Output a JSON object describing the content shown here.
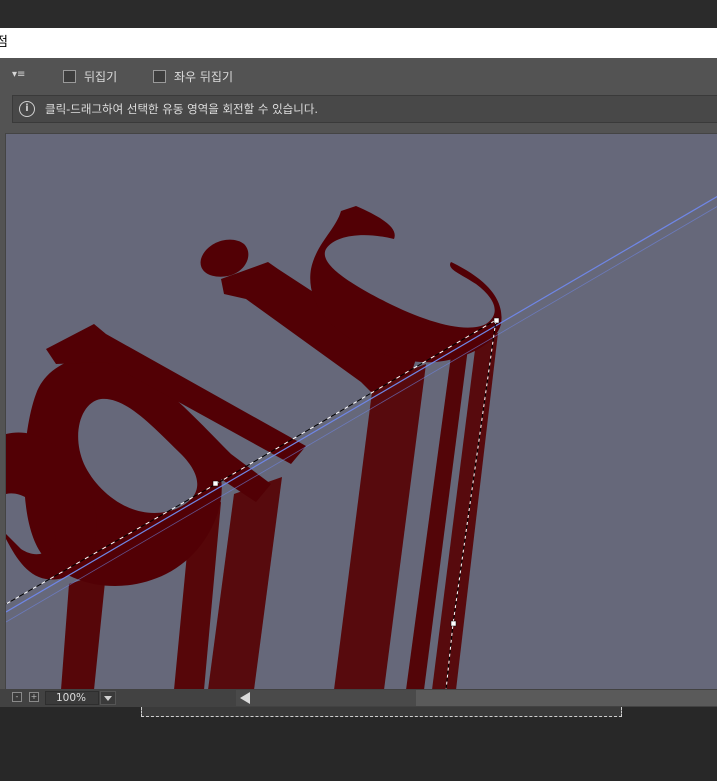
{
  "title": "점",
  "toolbar": {
    "menu_icon": "panel-menu-icon",
    "flip_vertical_label": "뒤집기",
    "flip_horizontal_label": "좌우 뒤집기"
  },
  "info": {
    "icon": "info-icon",
    "message": "클릭-드래그하여 선택한 유동 영역을 회전할 수 있습니다."
  },
  "status": {
    "zoom": "100%"
  },
  "canvas": {
    "background": "#66687a",
    "text_color": "#520005",
    "guide_color": "#6f86e6"
  }
}
